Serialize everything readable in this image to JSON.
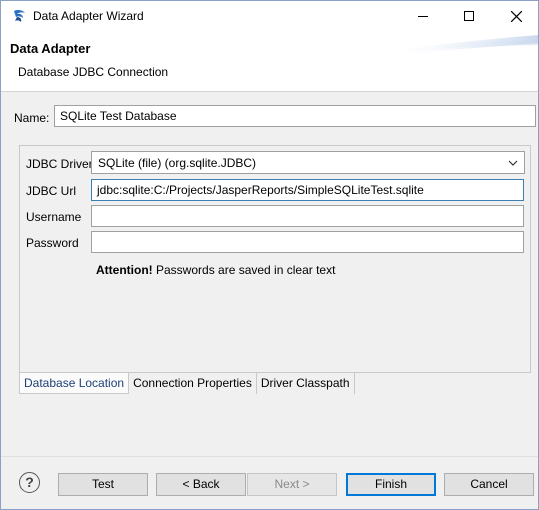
{
  "window": {
    "title": "Data Adapter Wizard"
  },
  "header": {
    "title": "Data Adapter",
    "subtitle": "Database JDBC Connection"
  },
  "form": {
    "name_label": "Name:",
    "name_value": "SQLite Test Database",
    "driver_label": "JDBC Driver",
    "driver_value": "SQLite (file) (org.sqlite.JDBC)",
    "url_label": "JDBC Url",
    "url_value": "jdbc:sqlite:C:/Projects/JasperReports/SimpleSQLiteTest.sqlite",
    "username_label": "Username",
    "username_value": "",
    "password_label": "Password",
    "password_value": "",
    "attention_bold": "Attention!",
    "attention_text": "Passwords are saved in clear text"
  },
  "tabs": [
    {
      "label": "Database Location",
      "active": true
    },
    {
      "label": "Connection Properties",
      "active": false
    },
    {
      "label": "Driver Classpath",
      "active": false
    }
  ],
  "footer": {
    "help_label": "?",
    "test_label": "Test",
    "back_label": "< Back",
    "next_label": "Next >",
    "finish_label": "Finish",
    "cancel_label": "Cancel"
  },
  "icons": {
    "app": "jaspersoft-icon",
    "minimize": "minimize-icon",
    "maximize": "maximize-icon",
    "close": "close-icon",
    "dropdown": "chevron-down-icon",
    "help": "help-icon"
  },
  "colors": {
    "accent": "#0078d7",
    "focus_border": "#3c7fb1"
  }
}
